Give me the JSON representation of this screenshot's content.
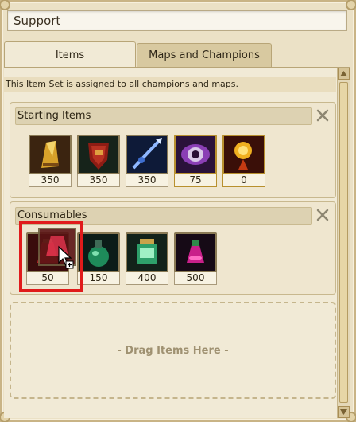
{
  "title_field": {
    "value": "Support"
  },
  "tabs": [
    {
      "label": "Items",
      "active": true
    },
    {
      "label": "Maps and Champions",
      "active": false
    }
  ],
  "notice": "This Item Set is assigned to all champions and maps.",
  "sections": [
    {
      "title": "Starting Items",
      "items": [
        {
          "icon": "gold-blade-icon",
          "price": "350",
          "gold_border": false
        },
        {
          "icon": "red-shield-icon",
          "price": "350",
          "gold_border": false
        },
        {
          "icon": "blue-spear-icon",
          "price": "350",
          "gold_border": false
        },
        {
          "icon": "purple-eye-ward-icon",
          "price": "75",
          "gold_border": true
        },
        {
          "icon": "yellow-trinket-icon",
          "price": "0",
          "gold_border": true
        }
      ]
    },
    {
      "title": "Consumables",
      "items": [
        {
          "icon": "red-potion-icon",
          "price": "50",
          "gold_border": false
        },
        {
          "icon": "green-flask-icon",
          "price": "150",
          "gold_border": false
        },
        {
          "icon": "green-elixir-icon",
          "price": "400",
          "gold_border": false
        },
        {
          "icon": "pink-flask-icon",
          "price": "500",
          "gold_border": false
        }
      ]
    }
  ],
  "drop_zone": {
    "label": "- Drag Items Here -"
  },
  "colors": {
    "highlight": "#e01b1b",
    "gold": "#b8902e",
    "parchment": "#efe6cf"
  }
}
